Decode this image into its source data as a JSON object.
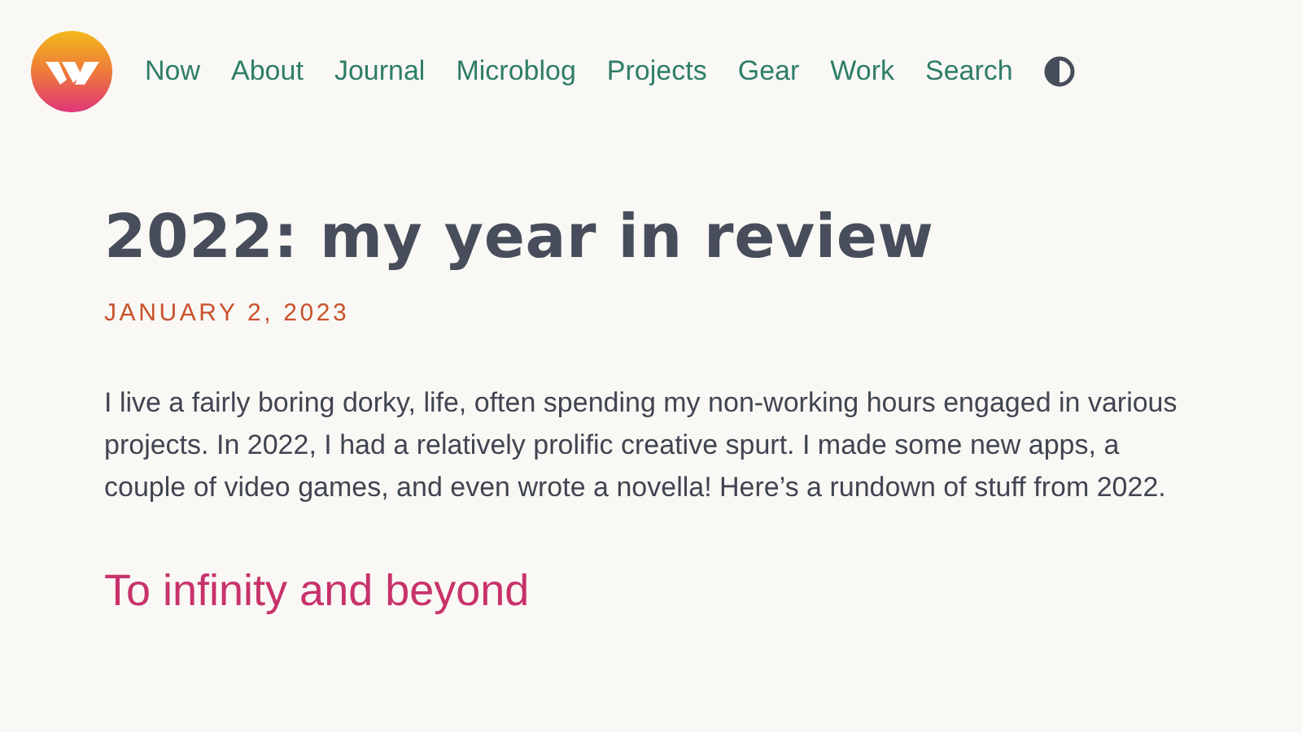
{
  "nav": {
    "items": [
      {
        "label": "Now"
      },
      {
        "label": "About"
      },
      {
        "label": "Journal"
      },
      {
        "label": "Microblog"
      },
      {
        "label": "Projects"
      },
      {
        "label": "Gear"
      },
      {
        "label": "Work"
      },
      {
        "label": "Search"
      }
    ]
  },
  "article": {
    "title": "2022: my year in review",
    "date": "JANUARY 2, 2023",
    "intro": "I live a fairly boring dorky, life, often spending my non-working hours engaged in various projects. In 2022, I had a relatively prolific creative spurt. I made some new apps, a couple of video games, and even wrote a novella! Here’s a rundown of stuff from 2022.",
    "heading": "To infinity and beyond"
  }
}
